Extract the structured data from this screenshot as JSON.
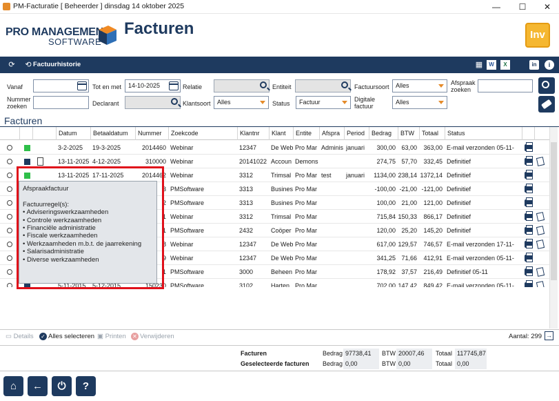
{
  "window": {
    "title": "PM-Facturatie  [ Beheerder ]  dinsdag 14 oktober 2025",
    "minimize": "—",
    "maximize": "☐",
    "close": "✕"
  },
  "header": {
    "logo_line1": "PRO MANAGEMENT",
    "logo_line2": "SOFTWARE",
    "page_title": "Facturen",
    "badge": "Inv"
  },
  "toolbar": {
    "history_label": "Factuurhistorie",
    "icons": [
      "refresh-icon",
      "history-icon",
      "calculator-icon",
      "word-icon",
      "excel-icon",
      "linkedin-icon",
      "info-icon"
    ]
  },
  "filters": {
    "vanaf_label": "Vanaf",
    "vanaf_value": "",
    "totmet_label": "Tot en met",
    "totmet_value": "14-10-2025",
    "relatie_label": "Relatie",
    "entiteit_label": "Entiteit",
    "factuursoort_label": "Factuursoort",
    "factuursoort_value": "Alles",
    "afspraak_label_1": "Afspraak",
    "afspraak_label_2": "zoeken",
    "nummer_label_1": "Nummer",
    "nummer_label_2": "zoeken",
    "declarant_label": "Declarant",
    "klantsoort_label": "Klantsoort",
    "klantsoort_value": "Alles",
    "status_label": "Status",
    "status_value": "Factuur",
    "digitale_label_1": "Digitale",
    "digitale_label_2": "factuur",
    "digitale_value": "Alles"
  },
  "section_title": "Facturen",
  "table": {
    "columns": [
      "Datum",
      "Betaaldatum",
      "Nummer",
      "Zoekcode",
      "Klantnr",
      "Klant",
      "Entite",
      "Afspra",
      "Period",
      "Bedrag",
      "BTW",
      "Totaal",
      "Status"
    ],
    "rows": [
      {
        "color": "#2fbf4a",
        "doc": false,
        "datum": "3-2-2025",
        "betaal": "19-3-2025",
        "nummer": "2014460",
        "zoekcode": "Webinar",
        "klantnr": "12347",
        "klant": "De Web",
        "entiteit": "Pro Mar",
        "afspraak": "Adminis",
        "periode": "januari",
        "bedrag": "300,00",
        "btw": "63,00",
        "totaal": "363,00",
        "status": "E-mail verzonden 05-11-",
        "note": false
      },
      {
        "color": "#1e3a5f",
        "doc": true,
        "datum": "13-11-2025",
        "betaal": "4-12-2025",
        "nummer": "310000",
        "zoekcode": "Webinar",
        "klantnr": "20141022",
        "klant": "Accoun",
        "entiteit": "Demons",
        "afspraak": "",
        "periode": "",
        "bedrag": "274,75",
        "btw": "57,70",
        "totaal": "332,45",
        "status": "Definitief",
        "note": true
      },
      {
        "color": "#2fbf4a",
        "doc": false,
        "datum": "13-11-2025",
        "betaal": "17-11-2025",
        "nummer": "2014462",
        "zoekcode": "Webinar",
        "klantnr": "3312",
        "klant": "Trimsal",
        "entiteit": "Pro Mar",
        "afspraak": "test",
        "periode": "januari",
        "bedrag": "1134,00",
        "btw": "238,14",
        "totaal": "1372,14",
        "status": "Definitief",
        "note": false
      },
      {
        "color": "#e0101a",
        "doc": false,
        "datum": "",
        "betaal": "",
        "nummer": "3",
        "zoekcode": "PMSoftware",
        "klantnr": "3313",
        "klant": "Busines",
        "entiteit": "Pro Mar",
        "afspraak": "",
        "periode": "",
        "bedrag": "-100,00",
        "btw": "-21,00",
        "totaal": "-121,00",
        "status": "Definitief",
        "note": false
      },
      {
        "color": "#1e3a5f",
        "doc": false,
        "datum": "",
        "betaal": "",
        "nummer": "2",
        "zoekcode": "PMSoftware",
        "klantnr": "3313",
        "klant": "Busines",
        "entiteit": "Pro Mar",
        "afspraak": "",
        "periode": "",
        "bedrag": "100,00",
        "btw": "21,00",
        "totaal": "121,00",
        "status": "Definitief",
        "note": false
      },
      {
        "color": "#1e3a5f",
        "doc": false,
        "datum": "",
        "betaal": "",
        "nummer": "1",
        "zoekcode": "Webinar",
        "klantnr": "3312",
        "klant": "Trimsal",
        "entiteit": "Pro Mar",
        "afspraak": "",
        "periode": "",
        "bedrag": "715,84",
        "btw": "150,33",
        "totaal": "866,17",
        "status": "Definitief",
        "note": true
      },
      {
        "color": "#1e3a5f",
        "doc": false,
        "datum": "",
        "betaal": "",
        "nummer": "1",
        "zoekcode": "PMSoftware",
        "klantnr": "2432",
        "klant": "Coöper",
        "entiteit": "Pro Mar",
        "afspraak": "",
        "periode": "",
        "bedrag": "120,00",
        "btw": "25,20",
        "totaal": "145,20",
        "status": "Definitief",
        "note": true
      },
      {
        "color": "#1e3a5f",
        "doc": false,
        "datum": "",
        "betaal": "",
        "nummer": "8",
        "zoekcode": "Webinar",
        "klantnr": "12347",
        "klant": "De Web",
        "entiteit": "Pro Mar",
        "afspraak": "",
        "periode": "",
        "bedrag": "617,00",
        "btw": "129,57",
        "totaal": "746,57",
        "status": "E-mail verzonden 17-11-",
        "note": true
      },
      {
        "color": "#f0a020",
        "doc": false,
        "datum": "",
        "betaal": "",
        "nummer": "9",
        "zoekcode": "Webinar",
        "klantnr": "12347",
        "klant": "De Web",
        "entiteit": "Pro Mar",
        "afspraak": "",
        "periode": "",
        "bedrag": "341,25",
        "btw": "71,66",
        "totaal": "412,91",
        "status": "E-mail verzonden 05-11-",
        "note": false
      },
      {
        "color": "#1e3a5f",
        "doc": false,
        "datum": "",
        "betaal": "",
        "nummer": "1",
        "zoekcode": "PMSoftware",
        "klantnr": "3000",
        "klant": "Beheen",
        "entiteit": "Pro Mar",
        "afspraak": "",
        "periode": "",
        "bedrag": "178,92",
        "btw": "37,57",
        "totaal": "216,49",
        "status": "Definitief 05-11",
        "note": true
      },
      {
        "color": "#1e3a5f",
        "doc": false,
        "datum": "5-11-2015",
        "betaal": "5-12-2015",
        "nummer": "150230",
        "zoekcode": "PMSoftware",
        "klantnr": "3102",
        "klant": "Harten,",
        "entiteit": "Pro Mar",
        "afspraak": "",
        "periode": "",
        "bedrag": "702,00",
        "btw": "147,42",
        "totaal": "849,42",
        "status": "E-mail verzonden 05-11-",
        "note": true
      }
    ]
  },
  "tooltip": {
    "lines": [
      "Afspraakfactuur",
      "",
      "Factuurregel(s):",
      "• Adviseringswerkzaamheden",
      "• Controle werkzaamheden",
      "• Financiële administratie",
      "• Fiscale werkzaamheden",
      "• Werkzaamheden m.b.t. de jaarrekening",
      "• Salarisadministratie",
      "• Diverse werkzaamheden"
    ]
  },
  "actions": {
    "details": "Details",
    "select_all": "Alles selecteren",
    "print": "Printen",
    "delete": "Verwijderen",
    "count": "Aantal: 299"
  },
  "totals": {
    "facturen_label": "Facturen",
    "selected_label": "Geselecteerde facturen",
    "bedrag_label": "Bedrag",
    "btw_label": "BTW",
    "totaal_label": "Totaal",
    "facturen_bedrag": "97738,41",
    "facturen_btw": "20007,46",
    "facturen_totaal": "117745,87",
    "selected_bedrag": "0,00",
    "selected_btw": "0,00",
    "selected_totaal": "0,00"
  },
  "bottom_nav": {
    "home": "⌂",
    "back": "←",
    "power": "⏻",
    "help": "?"
  }
}
